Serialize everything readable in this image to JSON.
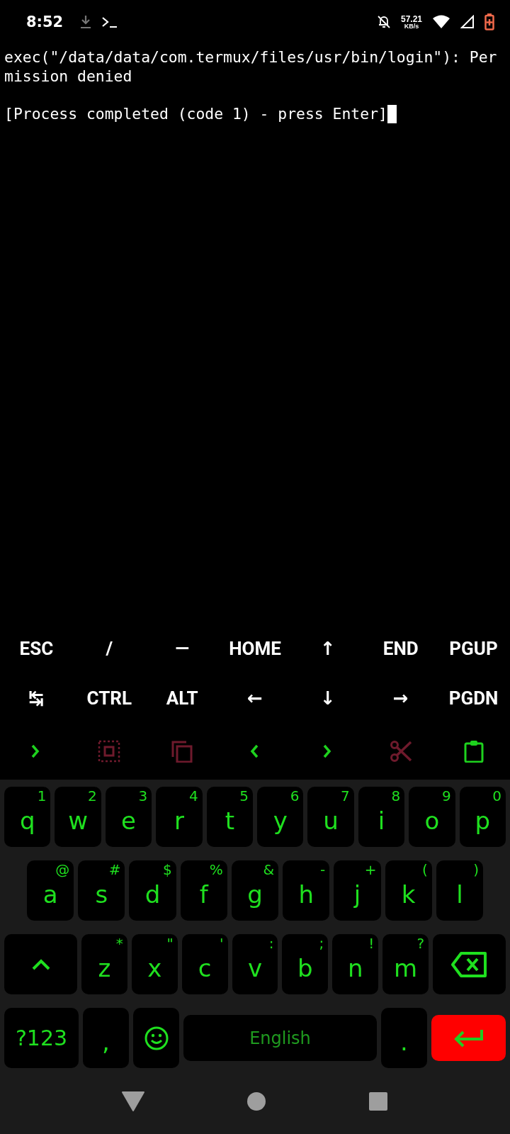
{
  "status_bar": {
    "time": "8:52",
    "net_speed": {
      "value": "57.21",
      "unit": "KB/s"
    }
  },
  "terminal": {
    "output": [
      "exec(\"/data/data/com.termux/files/usr/bin/login\"): Per",
      "mission denied"
    ],
    "prompt_line": "[Process completed (code 1) - press Enter]",
    "cursor": true
  },
  "extra_keys": {
    "rows": [
      [
        "ESC",
        "/",
        "—",
        "HOME",
        "↑",
        "END",
        "PGUP"
      ],
      [
        "↹",
        "CTRL",
        "ALT",
        "←",
        "↓",
        "→",
        "PGDN"
      ]
    ],
    "toolbar": [
      {
        "kind": "chevron-right",
        "disabled": false
      },
      {
        "kind": "select-all",
        "disabled": true
      },
      {
        "kind": "copy",
        "disabled": true
      },
      {
        "kind": "chevron-left",
        "disabled": false
      },
      {
        "kind": "chevron-right",
        "disabled": false
      },
      {
        "kind": "cut",
        "disabled": true
      },
      {
        "kind": "paste",
        "disabled": false
      }
    ]
  },
  "keyboard": {
    "rows": [
      [
        {
          "kind": "letter",
          "label": "q",
          "hint": "1"
        },
        {
          "kind": "letter",
          "label": "w",
          "hint": "2"
        },
        {
          "kind": "letter",
          "label": "e",
          "hint": "3"
        },
        {
          "kind": "letter",
          "label": "r",
          "hint": "4"
        },
        {
          "kind": "letter",
          "label": "t",
          "hint": "5"
        },
        {
          "kind": "letter",
          "label": "y",
          "hint": "6"
        },
        {
          "kind": "letter",
          "label": "u",
          "hint": "7"
        },
        {
          "kind": "letter",
          "label": "i",
          "hint": "8"
        },
        {
          "kind": "letter",
          "label": "o",
          "hint": "9"
        },
        {
          "kind": "letter",
          "label": "p",
          "hint": "0"
        }
      ],
      [
        {
          "kind": "letter",
          "label": "a",
          "hint": "@"
        },
        {
          "kind": "letter",
          "label": "s",
          "hint": "#"
        },
        {
          "kind": "letter",
          "label": "d",
          "hint": "$"
        },
        {
          "kind": "letter",
          "label": "f",
          "hint": "%"
        },
        {
          "kind": "letter",
          "label": "g",
          "hint": "&"
        },
        {
          "kind": "letter",
          "label": "h",
          "hint": "-"
        },
        {
          "kind": "letter",
          "label": "j",
          "hint": "+"
        },
        {
          "kind": "letter",
          "label": "k",
          "hint": "("
        },
        {
          "kind": "letter",
          "label": "l",
          "hint": ")"
        }
      ],
      [
        {
          "kind": "shift"
        },
        {
          "kind": "letter",
          "label": "z",
          "hint": "*"
        },
        {
          "kind": "letter",
          "label": "x",
          "hint": "\""
        },
        {
          "kind": "letter",
          "label": "c",
          "hint": "'"
        },
        {
          "kind": "letter",
          "label": "v",
          "hint": ":"
        },
        {
          "kind": "letter",
          "label": "b",
          "hint": ";"
        },
        {
          "kind": "letter",
          "label": "n",
          "hint": "!"
        },
        {
          "kind": "letter",
          "label": "m",
          "hint": "?"
        },
        {
          "kind": "backspace"
        }
      ]
    ],
    "bottom_row": {
      "symbols_key": "?123",
      "comma_key": ",",
      "space_bar": "English",
      "period_key": "."
    }
  }
}
